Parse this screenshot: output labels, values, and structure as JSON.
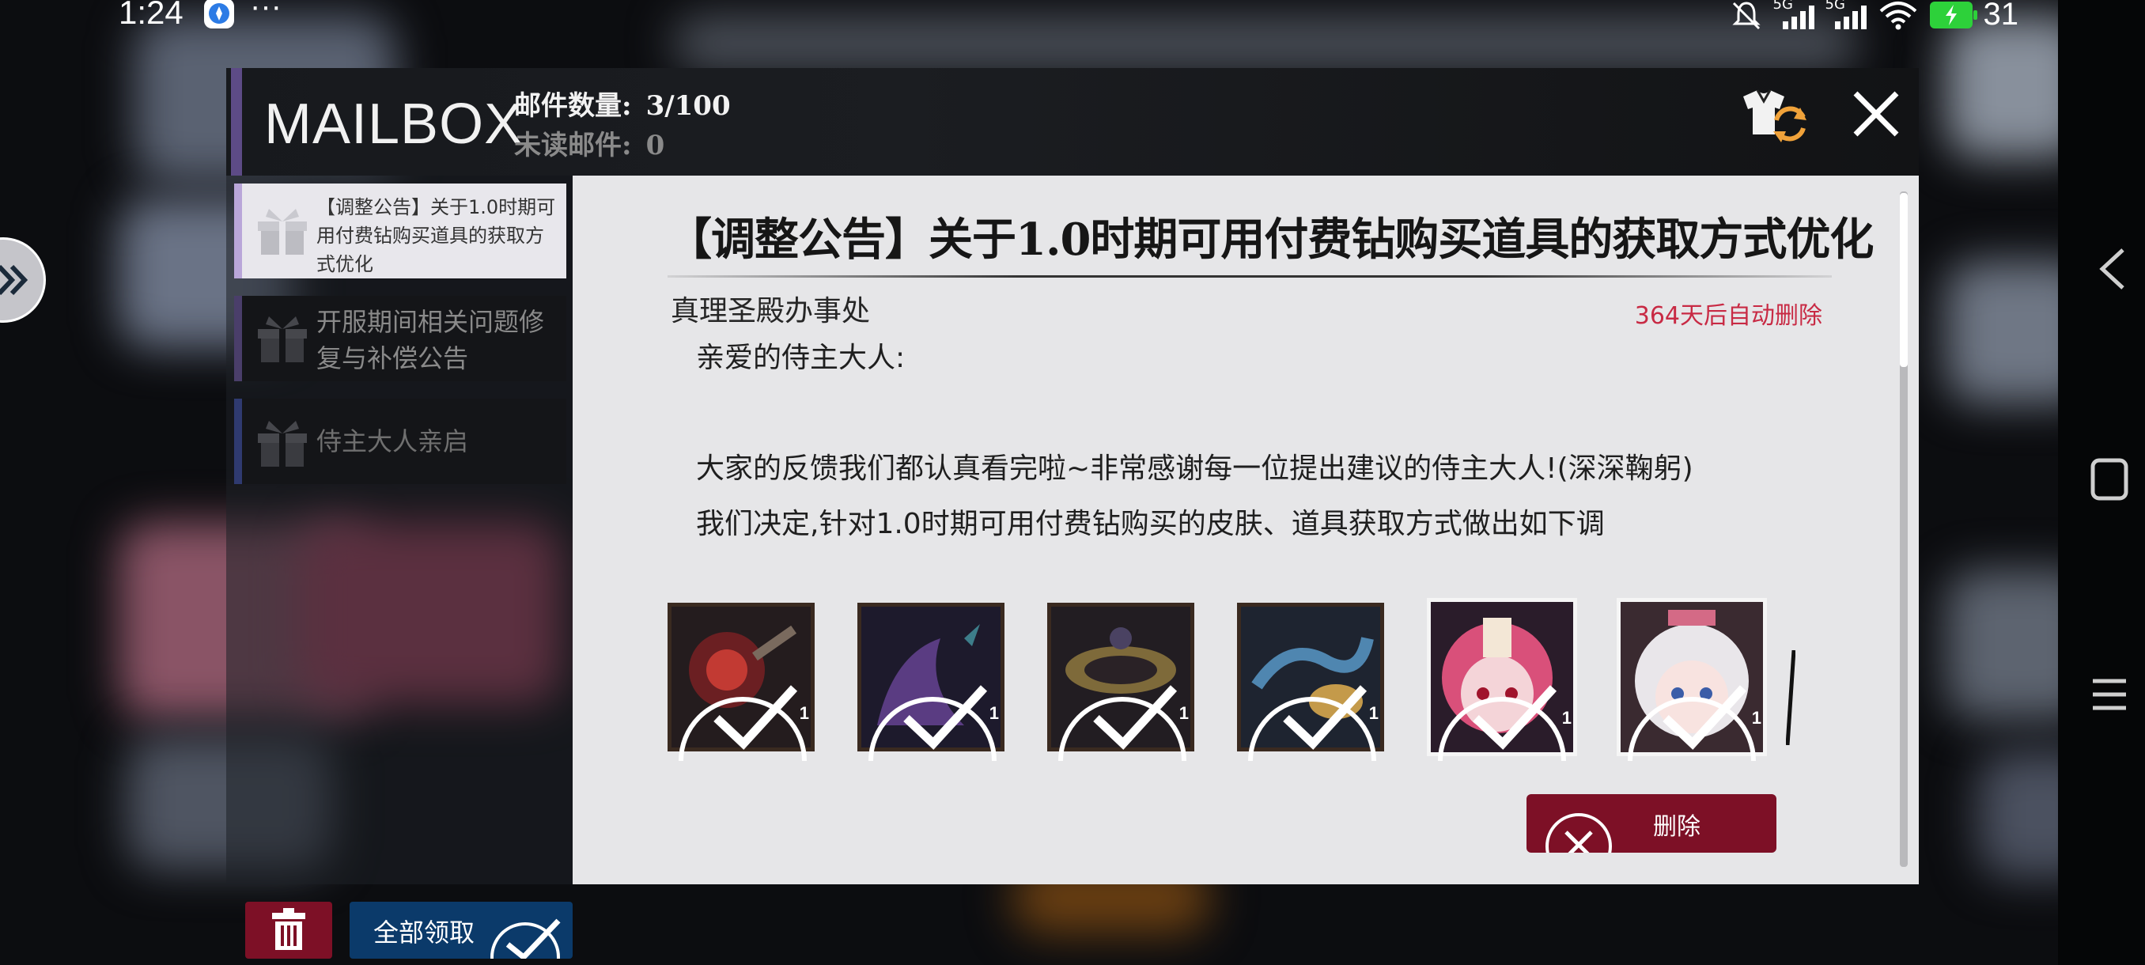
{
  "status_bar": {
    "time": "1:24",
    "more": "···",
    "signal_1": "5G",
    "signal_2": "5G",
    "battery": "31",
    "icons": [
      "app-notification-icon",
      "mute-bell-icon",
      "signal-icon",
      "wifi-icon",
      "battery-charging-icon"
    ]
  },
  "mailbox": {
    "title": "MAILBOX",
    "count_label": "邮件数量:",
    "count_value": "3/100",
    "unread_label": "未读邮件:",
    "unread_value": "0",
    "accent_color": "#5d4b86"
  },
  "mail_list": [
    {
      "title": "【调整公告】关于1.0时期可用付费钻购买道具的获取方式优化",
      "state": "selected"
    },
    {
      "title": "开服期间相关问题修复与补偿公告",
      "state": "read"
    },
    {
      "title": "侍主大人亲启",
      "state": "read"
    }
  ],
  "buttons": {
    "claim_all": "全部领取",
    "delete": "删除"
  },
  "message": {
    "title": "【调整公告】关于1.0时期可用付费钻购买道具的获取方式优化",
    "sender": "真理圣殿办事处",
    "expire": "364天后自动删除",
    "body": [
      "亲爱的侍主大人:",
      "",
      "大家的反馈我们都认真看完啦~非常感谢每一位提出建议的侍主大人!(深深鞠躬)",
      "我们决定,针对1.0时期可用付费钻购买的皮肤、道具获取方式做出如下调"
    ]
  },
  "rewards": [
    {
      "name": "reward-item-1",
      "qty": "1",
      "claimed": true
    },
    {
      "name": "reward-item-2",
      "qty": "1",
      "claimed": true
    },
    {
      "name": "reward-item-3",
      "qty": "1",
      "claimed": true
    },
    {
      "name": "reward-item-4",
      "qty": "1",
      "claimed": true
    },
    {
      "name": "reward-skin-1",
      "qty": "1",
      "claimed": true
    },
    {
      "name": "reward-skin-2",
      "qty": "1",
      "claimed": true
    }
  ],
  "colors": {
    "delete_red": "#7d1026",
    "claim_blue": "#0b3a6a",
    "expire_red": "#c82a44"
  }
}
